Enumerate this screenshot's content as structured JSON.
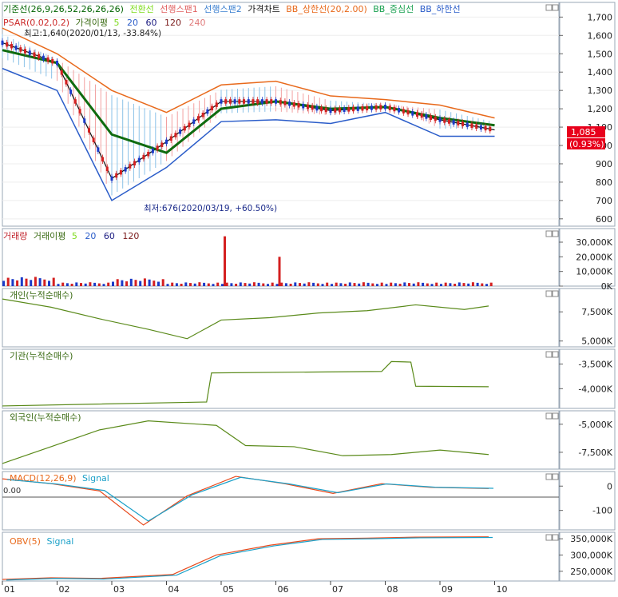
{
  "window": {
    "bg": "#ffffff",
    "border": "#9aa7b6"
  },
  "price_panel": {
    "legend": [
      {
        "text": "기준선(26,9,26,52,26,26,26)",
        "color": "#006400"
      },
      {
        "text": "전환선",
        "color": "#7fdc1e"
      },
      {
        "text": "선행스팬1",
        "color": "#e06060"
      },
      {
        "text": "선행스팬2",
        "color": "#3a7fd0"
      },
      {
        "text": "가격차트",
        "color": "#111111"
      },
      {
        "text": "BB_상한선(20,2.00)",
        "color": "#e8691b"
      },
      {
        "text": "BB_중심선",
        "color": "#18a050"
      },
      {
        "text": "BB_하한선",
        "color": "#2a5cc9"
      }
    ],
    "legend2": [
      {
        "text": "PSAR(0.02,0.2)",
        "color": "#cc2a2a"
      },
      {
        "text": "가격이평",
        "color": "#3b6b14"
      },
      {
        "text": "5",
        "color": "#7fdc1e"
      },
      {
        "text": "20",
        "color": "#2a5cc9"
      },
      {
        "text": "60",
        "color": "#1a1a80"
      },
      {
        "text": "120",
        "color": "#7a1a1a"
      },
      {
        "text": "240",
        "color": "#e07a7a"
      }
    ],
    "max_note": "최고:1,640(2020/01/13, -33.84%)",
    "min_note": "최저:676(2020/03/19, +60.50%)",
    "y_ticks": [
      "1,700",
      "1,600",
      "1,500",
      "1,400",
      "1,300",
      "1,200",
      "1,100",
      "1,000",
      "900",
      "800",
      "700",
      "600"
    ],
    "current_price": "1,085",
    "current_change": "(0.93%)"
  },
  "volume_panel": {
    "legend": [
      {
        "text": "거래량",
        "color": "#c0232c"
      },
      {
        "text": "거래이평",
        "color": "#3b6b14"
      },
      {
        "text": "5",
        "color": "#7fdc1e"
      },
      {
        "text": "20",
        "color": "#2a5cc9"
      },
      {
        "text": "60",
        "color": "#1a1a80"
      },
      {
        "text": "120",
        "color": "#7a1a1a"
      }
    ],
    "y_ticks": [
      "30,000K",
      "20,000K",
      "10,000K",
      "0K"
    ]
  },
  "individual_panel": {
    "title": "개인(누적순매수)",
    "y_ticks": [
      "7,500K",
      "5,000K"
    ],
    "color": "#5a8a1a"
  },
  "institution_panel": {
    "title": "기관(누적순매수)",
    "y_ticks": [
      "-3,500K",
      "-4,000K"
    ],
    "color": "#5a8a1a"
  },
  "foreign_panel": {
    "title": "외국인(누적순매수)",
    "y_ticks": [
      "-5,000K",
      "-7,500K"
    ],
    "color": "#5a8a1a"
  },
  "macd_panel": {
    "title": "MACD(12,26,9)",
    "signal": "Signal",
    "zero_label": "0.00",
    "y_ticks": [
      "0",
      "-100"
    ]
  },
  "obv_panel": {
    "title": "OBV(5)",
    "signal": "Signal",
    "y_ticks": [
      "350,000K",
      "300,000K",
      "250,000K"
    ]
  },
  "x_axis": {
    "labels": [
      "01",
      "02",
      "03",
      "04",
      "05",
      "06",
      "07",
      "08",
      "09",
      "10"
    ]
  },
  "chart_data": [
    {
      "type": "line",
      "title": "가격차트",
      "x": [
        "2020-01",
        "2020-02",
        "2020-03",
        "2020-04",
        "2020-05",
        "2020-06",
        "2020-07",
        "2020-08",
        "2020-09",
        "2020-10"
      ],
      "series": [
        {
          "name": "가격차트",
          "values": [
            1560,
            1450,
            820,
            1020,
            1240,
            1240,
            1190,
            1210,
            1140,
            1085
          ]
        },
        {
          "name": "BB_상한선",
          "values": [
            1640,
            1500,
            1300,
            1180,
            1330,
            1350,
            1270,
            1250,
            1220,
            1150
          ]
        },
        {
          "name": "BB_하한선",
          "values": [
            1420,
            1300,
            700,
            880,
            1130,
            1140,
            1120,
            1180,
            1050,
            1050
          ]
        },
        {
          "name": "기준선",
          "values": [
            1520,
            1450,
            1060,
            960,
            1200,
            1240,
            1200,
            1210,
            1150,
            1110
          ]
        }
      ],
      "ylim": [
        560,
        1780
      ]
    },
    {
      "type": "bar",
      "title": "거래량",
      "spikes": [
        {
          "month": "2020-05",
          "value": 34000
        },
        {
          "month": "2020-06",
          "value": 20000
        }
      ],
      "ylim": [
        0,
        36000
      ]
    },
    {
      "type": "line",
      "title": "개인(누적순매수)",
      "x_frac": [
        0.0,
        0.1,
        0.2,
        0.3,
        0.38,
        0.45,
        0.55,
        0.65,
        0.75,
        0.85,
        0.95,
        1.0
      ],
      "values": [
        8600,
        7900,
        6900,
        6000,
        5200,
        6800,
        7000,
        7400,
        7600,
        8100,
        7700,
        8000
      ],
      "ylim": [
        4500,
        9500
      ]
    },
    {
      "type": "line",
      "title": "기관(누적순매수)",
      "x_frac": [
        0.0,
        0.42,
        0.43,
        0.78,
        0.8,
        0.84,
        0.85,
        1.0
      ],
      "values": [
        -4350,
        -4270,
        -3680,
        -3650,
        -3450,
        -3460,
        -3950,
        -3960
      ],
      "ylim": [
        -4400,
        -3200
      ]
    },
    {
      "type": "line",
      "title": "외국인(누적순매수)",
      "x_frac": [
        0.0,
        0.1,
        0.2,
        0.3,
        0.44,
        0.5,
        0.6,
        0.7,
        0.8,
        0.9,
        1.0
      ],
      "values": [
        -8500,
        -7000,
        -5500,
        -4700,
        -5100,
        -6900,
        -7000,
        -7800,
        -7700,
        -7300,
        -7700
      ],
      "ylim": [
        -9000,
        -3800
      ]
    },
    {
      "type": "line",
      "title": "MACD(12,26,9)",
      "x_frac": [
        0.0,
        0.1,
        0.2,
        0.29,
        0.38,
        0.48,
        0.58,
        0.68,
        0.78,
        0.88,
        1.0
      ],
      "values": [
        30,
        10,
        -20,
        -160,
        -40,
        40,
        10,
        -30,
        10,
        -5,
        -10
      ],
      "ylim": [
        -180,
        60
      ]
    },
    {
      "type": "line",
      "title": "OBV(5)",
      "x_frac": [
        0.0,
        0.1,
        0.2,
        0.35,
        0.44,
        0.55,
        0.65,
        0.75,
        0.85,
        1.0
      ],
      "values": [
        225000,
        230000,
        228000,
        240000,
        300000,
        330000,
        350000,
        352000,
        355000,
        356000
      ],
      "ylim": [
        220000,
        370000
      ]
    }
  ]
}
